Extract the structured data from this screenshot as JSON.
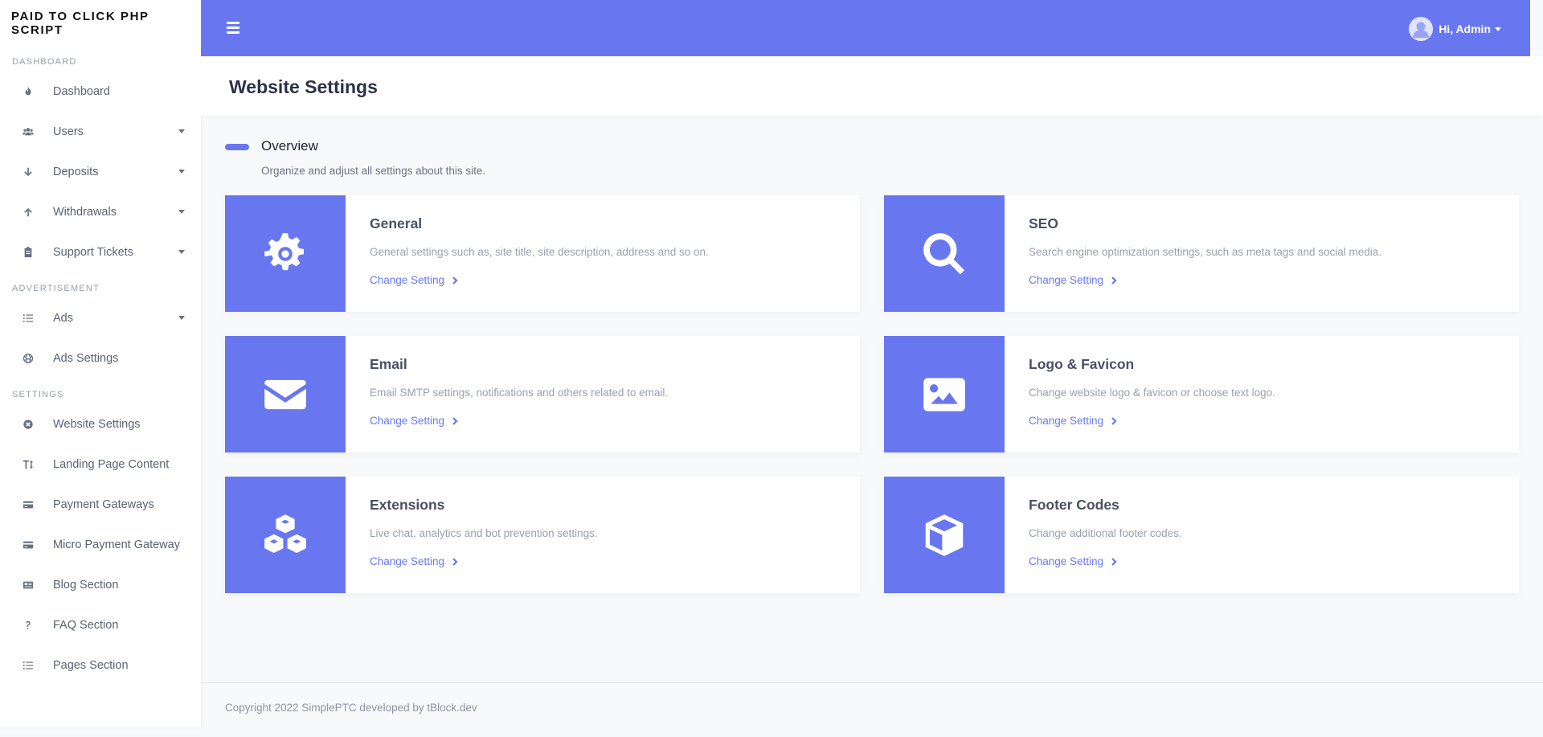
{
  "brand": "PAID TO CLICK PHP SCRIPT",
  "sidebar": {
    "sections": [
      {
        "title": "DASHBOARD",
        "items": [
          {
            "label": "Dashboard",
            "icon": "flame-icon",
            "caret": false
          },
          {
            "label": "Users",
            "icon": "users-icon",
            "caret": true
          },
          {
            "label": "Deposits",
            "icon": "arrow-down-icon",
            "caret": true
          },
          {
            "label": "Withdrawals",
            "icon": "arrow-up-icon",
            "caret": true
          },
          {
            "label": "Support Tickets",
            "icon": "clipboard-icon",
            "caret": true
          }
        ]
      },
      {
        "title": "ADVERTISEMENT",
        "items": [
          {
            "label": "Ads",
            "icon": "list-icon",
            "caret": true
          },
          {
            "label": "Ads Settings",
            "icon": "globe-icon",
            "caret": false
          }
        ]
      },
      {
        "title": "SETTINGS",
        "items": [
          {
            "label": "Website Settings",
            "icon": "settings-circle-icon",
            "caret": false
          },
          {
            "label": "Landing Page Content",
            "icon": "text-height-icon",
            "caret": false
          },
          {
            "label": "Payment Gateways",
            "icon": "credit-card-icon",
            "caret": false
          },
          {
            "label": "Micro Payment Gateway",
            "icon": "credit-card-icon",
            "caret": false
          },
          {
            "label": "Blog Section",
            "icon": "newspaper-icon",
            "caret": false
          },
          {
            "label": "FAQ Section",
            "icon": "question-icon",
            "caret": false
          },
          {
            "label": "Pages Section",
            "icon": "list-icon",
            "caret": false
          }
        ]
      }
    ]
  },
  "topbar": {
    "user_label": "Hi, Admin"
  },
  "page": {
    "title": "Website Settings",
    "overview_title": "Overview",
    "overview_desc": "Organize and adjust all settings about this site."
  },
  "cards": [
    {
      "title": "General",
      "desc": "General settings such as, site title, site description, address and so on.",
      "link": "Change Setting",
      "icon": "gear-icon"
    },
    {
      "title": "SEO",
      "desc": "Search engine optimization settings, such as meta tags and social media.",
      "link": "Change Setting",
      "icon": "search-icon"
    },
    {
      "title": "Email",
      "desc": "Email SMTP settings, notifications and others related to email.",
      "link": "Change Setting",
      "icon": "envelope-icon"
    },
    {
      "title": "Logo & Favicon",
      "desc": "Change website logo & favicon or choose text logo.",
      "link": "Change Setting",
      "icon": "image-icon"
    },
    {
      "title": "Extensions",
      "desc": "Live chat, analytics and bot prevention settings.",
      "link": "Change Setting",
      "icon": "cubes-icon"
    },
    {
      "title": "Footer Codes",
      "desc": "Change additional footer codes.",
      "link": "Change Setting",
      "icon": "cube-icon"
    }
  ],
  "footer": "Copyright 2022 SimplePTC developed by tBlock.dev",
  "colors": {
    "primary": "#6877ef",
    "sidebar_bg": "#ffffff",
    "page_bg": "#f8f9fb"
  }
}
